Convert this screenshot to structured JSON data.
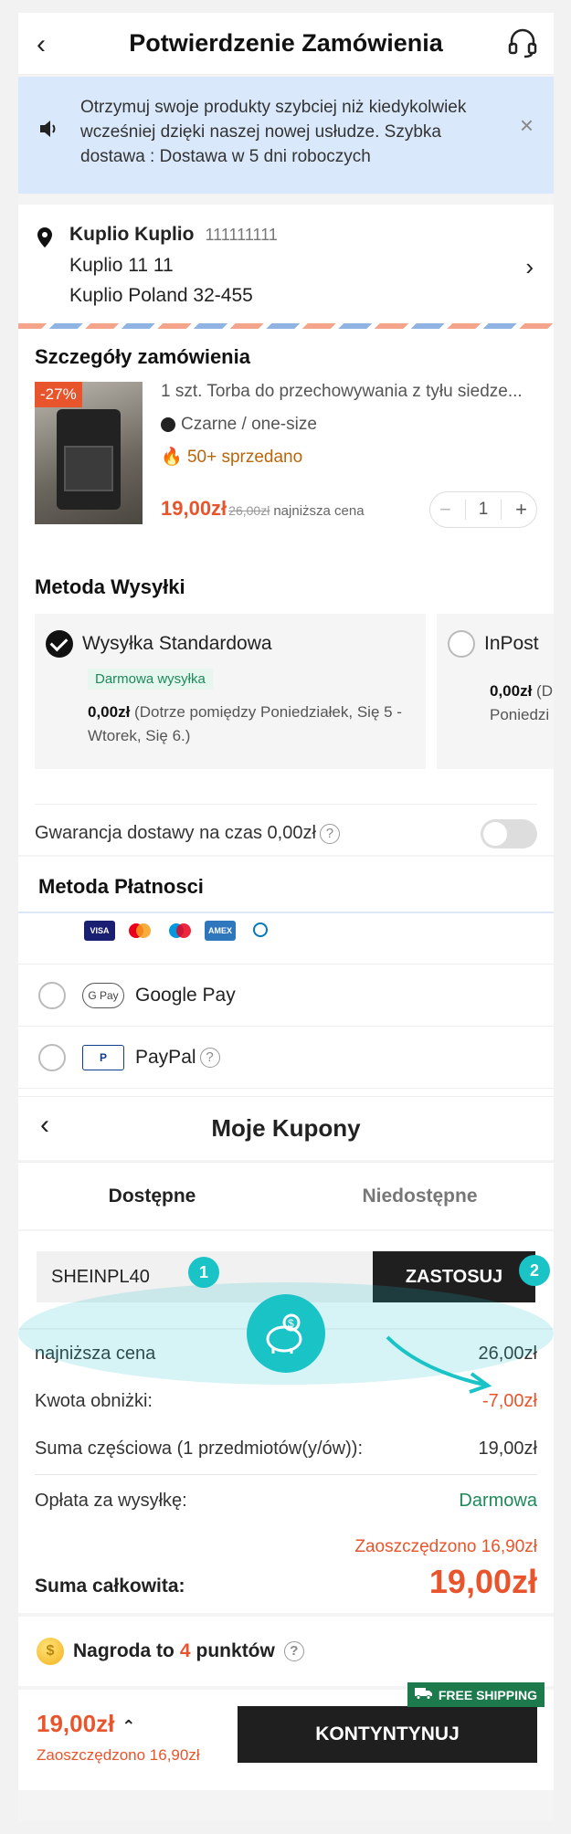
{
  "header": {
    "title": "Potwierdzenie Zamówienia"
  },
  "banner": {
    "text": "Otrzymuj swoje produkty szybciej niż kiedykolwiek wcześniej dzięki naszej nowej usłudze. Szybka dostawa : Dostawa w 5 dni roboczych",
    "close": "×"
  },
  "address": {
    "name": "Kuplio Kuplio",
    "phone": "111111111",
    "line1": "Kuplio 11 11",
    "line2": "Kuplio Poland 32-455"
  },
  "order": {
    "title": "Szczegóły zamówienia",
    "discount_badge": "-27%",
    "product_name": "1 szt. Torba do przechowywania z tyłu siedze...",
    "variant": "Czarne / one-size",
    "sold": "50+ sprzedano",
    "price": "19,00zł",
    "old_price": "26,00zł",
    "lowest_label": "najniższa cena",
    "quantity": "1"
  },
  "shipping": {
    "title": "Metoda Wysyłki",
    "standard": {
      "name": "Wysyłka Standardowa",
      "tag": "Darmowa wysyłka",
      "price": "0,00zł",
      "details": "(Dotrze pomiędzy Poniedziałek, Się 5 - Wtorek, Się 6.)"
    },
    "inpost": {
      "name": "InPost",
      "price": "0,00zł",
      "details": "(D",
      "details2": "Poniedzi"
    },
    "guarantee": "Gwarancja dostawy na czas 0,00zł"
  },
  "payment": {
    "title": "Metoda Płatnosci",
    "google_pay": "Google Pay",
    "paypal": "PayPal"
  },
  "coupons": {
    "title": "Moje Kupony",
    "tab_available": "Dostępne",
    "tab_unavailable": "Niedostępne",
    "code": "SHEINPL40",
    "apply": "ZASTOSUJ",
    "step1": "1",
    "step2": "2"
  },
  "summary": {
    "lowest_label": "najniższa cena",
    "lowest_value": "26,00zł",
    "discount_label": "Kwota obniżki:",
    "discount_value": "-7,00zł",
    "subtotal_label": "Suma częściowa (1 przedmiotów(y/ów)):",
    "subtotal_value": "19,00zł",
    "shipping_label": "Opłata za wysyłkę:",
    "shipping_value": "Darmowa",
    "saved": "Zaoszczędzono 16,90zł",
    "total_label": "Suma całkowita:",
    "total_value": "19,00zł"
  },
  "reward": {
    "prefix": "Nagroda to",
    "points": "4",
    "suffix": "punktów"
  },
  "bottom": {
    "price": "19,00zł",
    "saved": "Zaoszczędzono 16,90zł",
    "cta": "KONTYNTYNUJ",
    "free_shipping": "FREE SHIPPING"
  },
  "colors": {
    "accent": "#e8552d",
    "teal": "#19c3c6",
    "green": "#1d8a5a"
  }
}
